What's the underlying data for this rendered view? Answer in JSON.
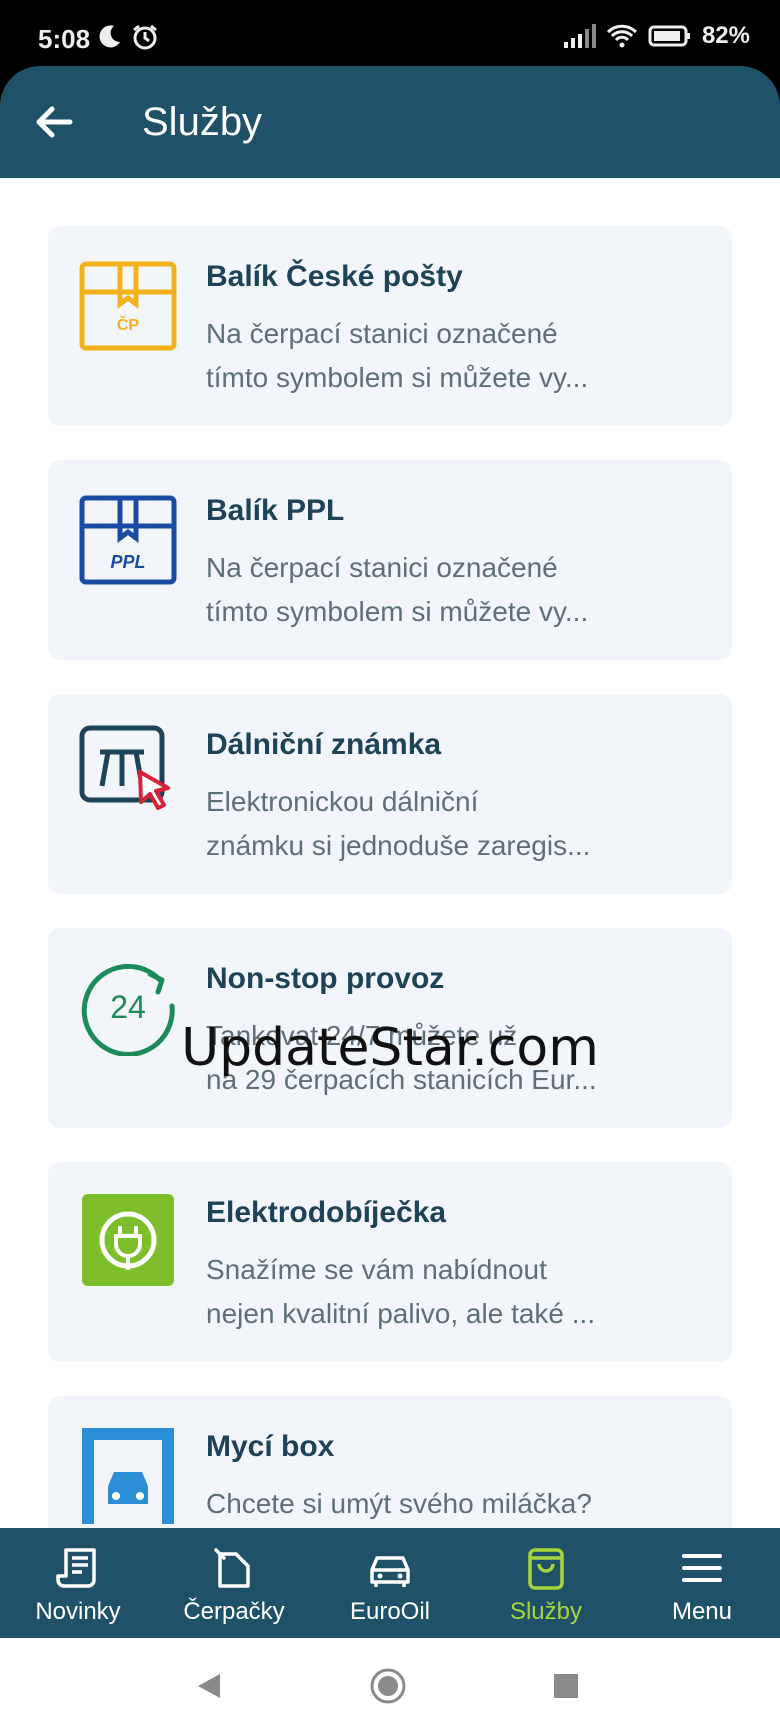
{
  "status_bar": {
    "time": "5:08",
    "battery": "82"
  },
  "app_bar": {
    "title": "Služby"
  },
  "services": [
    {
      "title": "Balík České pošty",
      "line1": "Na čerpací stanici označené",
      "line2": "tímto symbolem si můžete vy...",
      "icon": "ceska-posta-package-icon"
    },
    {
      "title": "Balík PPL",
      "line1": "Na čerpací stanici označené",
      "line2": "tímto symbolem si můžete vy...",
      "icon": "ppl-package-icon"
    },
    {
      "title": "Dálniční známka",
      "line1": "Elektronickou dálniční",
      "line2": "známku si jednoduše zaregis...",
      "icon": "highway-vignette-icon"
    },
    {
      "title": "Non-stop provoz",
      "line1": "Tankovat 24/7 můžete už",
      "line2": "na 29 čerpacích stanicích Eur...",
      "icon": "nonstop-24-icon"
    },
    {
      "title": "Elektrodobíječka",
      "line1": "Snažíme se vám nabídnout",
      "line2": "nejen kvalitní palivo, ale také ...",
      "icon": "ev-charger-icon"
    },
    {
      "title": "Mycí box",
      "line1": "Chcete si umýt svého miláčka?",
      "line2": "",
      "icon": "car-wash-icon"
    }
  ],
  "watermark": "UpdateStar.com",
  "bottom_nav": [
    {
      "label": "Novinky",
      "icon": "news-icon"
    },
    {
      "label": "Čerpačky",
      "icon": "fuel-station-icon"
    },
    {
      "label": "EuroOil",
      "icon": "car-icon"
    },
    {
      "label": "Služby",
      "icon": "shopping-bag-icon",
      "active": true
    },
    {
      "label": "Menu",
      "icon": "menu-icon"
    }
  ],
  "colors": {
    "primary": "#1f5268",
    "accent": "#a7d43c",
    "card_bg": "#f2f5f9",
    "posta_yellow": "#f3b21c",
    "ppl_blue": "#1b4ba0",
    "ev_green": "#7cbf2a",
    "nonstop_green": "#1c8a5a",
    "vignette_red": "#d6223b"
  }
}
